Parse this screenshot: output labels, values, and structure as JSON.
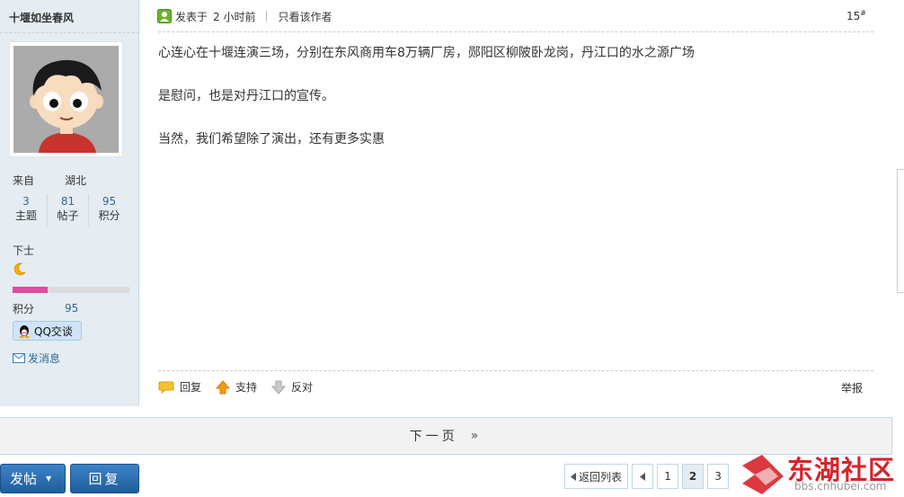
{
  "user": {
    "name": "十堰如坐春风",
    "from_label": "来自",
    "from_value": "湖北",
    "stats": [
      {
        "num": "3",
        "label": "主题"
      },
      {
        "num": "81",
        "label": "帖子"
      },
      {
        "num": "95",
        "label": "积分"
      }
    ],
    "rank": "下士",
    "rank_progress": 0.3,
    "points_label": "积分",
    "points_value": "95",
    "qq_label": "QQ交谈",
    "message_label": "发消息"
  },
  "post": {
    "posted_prefix": "发表于",
    "posted_time": "2 小时前",
    "author_only": "只看该作者",
    "floor_number": "15",
    "floor_mark": "#",
    "paragraphs": [
      "心连心在十堰连演三场，分别在东风商用车8万辆厂房，郧阳区柳陂卧龙岗，丹江口的水之源广场",
      "是慰问，也是对丹江口的宣传。",
      "当然，我们希望除了演出，还有更多实惠"
    ],
    "actions": {
      "reply": "回复",
      "support": "支持",
      "oppose": "反对",
      "report": "举报"
    }
  },
  "next_page": {
    "label": "下一页",
    "arrow": "»"
  },
  "bottom": {
    "post_button": "发帖",
    "reply_button": "回复",
    "pager": {
      "back_label": "返回列表",
      "pages": [
        "1",
        "2",
        "3"
      ],
      "current": "2"
    }
  },
  "logo": {
    "text": "东湖社区",
    "url_text": "bbs.cnhubei.com"
  },
  "colors": {
    "side_bg": "#e5edf2",
    "button_blue": "#2c6fb4",
    "progress_pink": "#e04ca0",
    "link_blue": "#336699",
    "logo_red": "#d7232b"
  }
}
